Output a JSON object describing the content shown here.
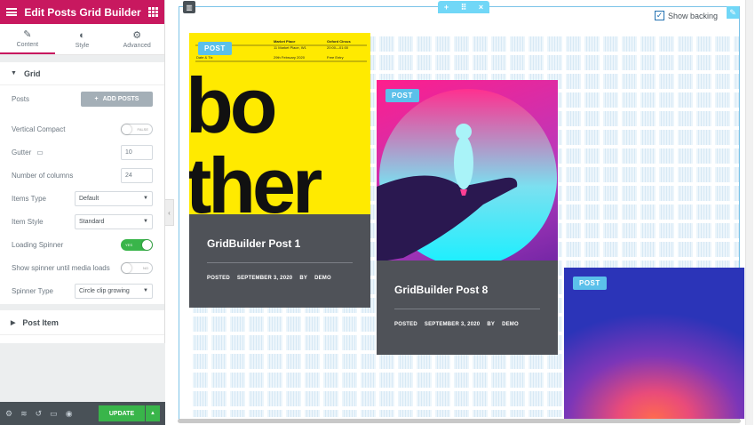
{
  "panel": {
    "title": "Edit Posts Grid Builder",
    "tabs": [
      {
        "label": "Content",
        "icon": "pencil-icon"
      },
      {
        "label": "Style",
        "icon": "half-circle-icon"
      },
      {
        "label": "Advanced",
        "icon": "gear-icon"
      }
    ],
    "section_title": "Grid",
    "controls": {
      "posts_label": "Posts",
      "add_posts_label": "ADD POSTS",
      "vertical_compact_label": "Vertical Compact",
      "vertical_compact_value": "FALSE",
      "gutter_label": "Gutter",
      "gutter_value": "10",
      "columns_label": "Number of columns",
      "columns_value": "24",
      "items_type_label": "Items Type",
      "items_type_value": "Default",
      "item_style_label": "Item Style",
      "item_style_value": "Standard",
      "loading_spinner_label": "Loading Spinner",
      "loading_spinner_value": "YES",
      "show_spinner_label": "Show spinner until media loads",
      "show_spinner_value": "NO",
      "spinner_type_label": "Spinner Type",
      "spinner_type_value": "Circle clip growing"
    },
    "post_item_title": "Post Item",
    "update_label": "UPDATE"
  },
  "preview": {
    "show_background_label": "Show backing",
    "show_background_checked": true,
    "cards": [
      {
        "badge": "POST",
        "title": "GridBuilder Post 1",
        "posted": "POSTED",
        "date": "SEPTEMBER 3, 2020",
        "by": "BY",
        "author": "DEMO",
        "poster_top": [
          "Date & Tix",
          "Market Place",
          "11 Market Place, W1",
          "29th February 2020",
          "Oxford Circus",
          "20:00—01:00",
          "Free Entry"
        ],
        "poster_word_1": "bo",
        "poster_word_2": "ther"
      },
      {
        "badge": "POST",
        "title": "GridBuilder Post 8",
        "posted": "POSTED",
        "date": "SEPTEMBER 3, 2020",
        "by": "BY",
        "author": "DEMO"
      },
      {
        "badge": "POST"
      }
    ]
  },
  "colors": {
    "brand": "#c8185f",
    "accent": "#5bc0ea",
    "update": "#39b54a",
    "caption_bg": "#4f5258"
  }
}
